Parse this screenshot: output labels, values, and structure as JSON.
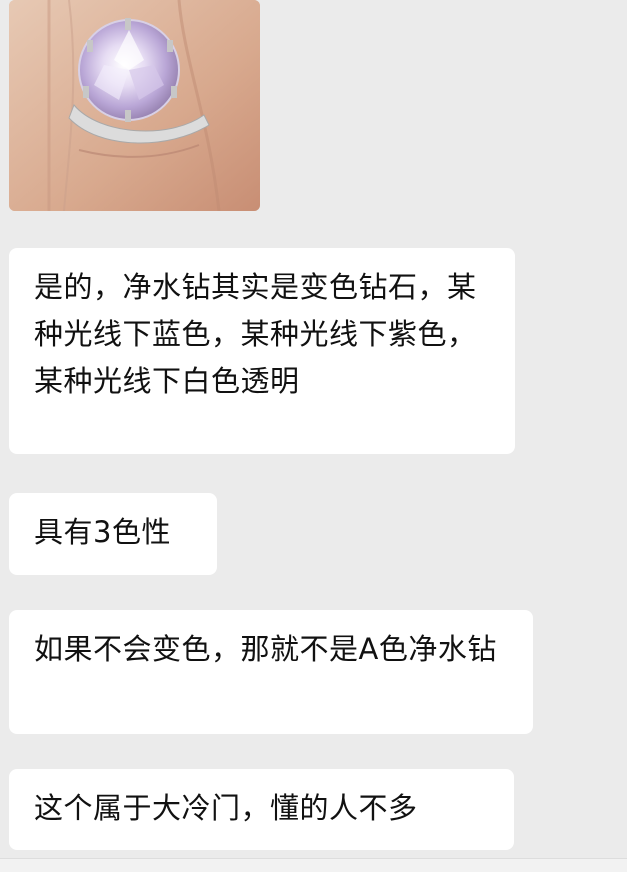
{
  "chat": {
    "photo": {
      "alt": "ring-on-finger-photo",
      "icon": "ring-photo"
    },
    "messages": [
      {
        "text": "是的，净水钻其实是变色钻石，某种光线下蓝色，某种光线下紫色，某种光线下白色透明"
      },
      {
        "text": "具有3色性"
      },
      {
        "text": "如果不会变色，那就不是A色净水钻"
      },
      {
        "text": "这个属于大冷门，懂的人不多"
      }
    ]
  }
}
